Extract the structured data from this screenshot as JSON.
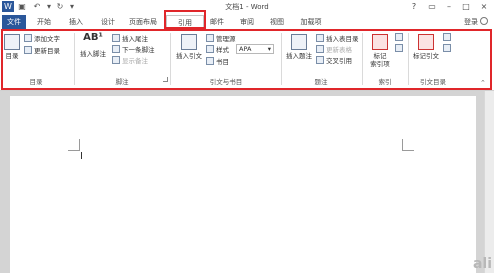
{
  "title_bar": {
    "title": "文档1 - Word",
    "quick_access": [
      "word-logo-icon",
      "save-icon",
      "undo-icon",
      "redo-icon",
      "customize-icon"
    ],
    "window_controls": [
      "help-icon",
      "ribbon-options-icon",
      "minimize-icon",
      "maximize-icon",
      "close-icon"
    ]
  },
  "tabs": [
    {
      "label": "文件"
    },
    {
      "label": "开始"
    },
    {
      "label": "插入"
    },
    {
      "label": "设计"
    },
    {
      "label": "页面布局"
    },
    {
      "label": "引用"
    },
    {
      "label": "邮件"
    },
    {
      "label": "审阅"
    },
    {
      "label": "视图"
    },
    {
      "label": "加载项"
    }
  ],
  "login": "登录",
  "ribbon": {
    "toc": {
      "big": "目录",
      "add_text": "添加文字",
      "update_toc": "更新目录",
      "group": "目录"
    },
    "footnotes": {
      "big": "插入脚注",
      "insert_endnote": "插入尾注",
      "next_footnote": "下一条脚注",
      "show_notes": "显示备注",
      "group": "脚注"
    },
    "citations": {
      "big": "插入引文",
      "manage_sources": "管理源",
      "style_label": "样式",
      "style_value": "APA",
      "bibliography": "书目",
      "group": "引文与书目"
    },
    "captions": {
      "big": "插入题注",
      "insert_tof": "插入表目录",
      "update_table": "更新表格",
      "cross_ref": "交叉引用",
      "group": "题注"
    },
    "index": {
      "big": "标记\n索引项",
      "group": "索引"
    },
    "toa": {
      "big": "标记引文",
      "group": "引文目录"
    }
  },
  "accent_colors": {
    "file_tab": "#2b579a",
    "highlight": "#e0262a"
  },
  "watermark": "ali"
}
